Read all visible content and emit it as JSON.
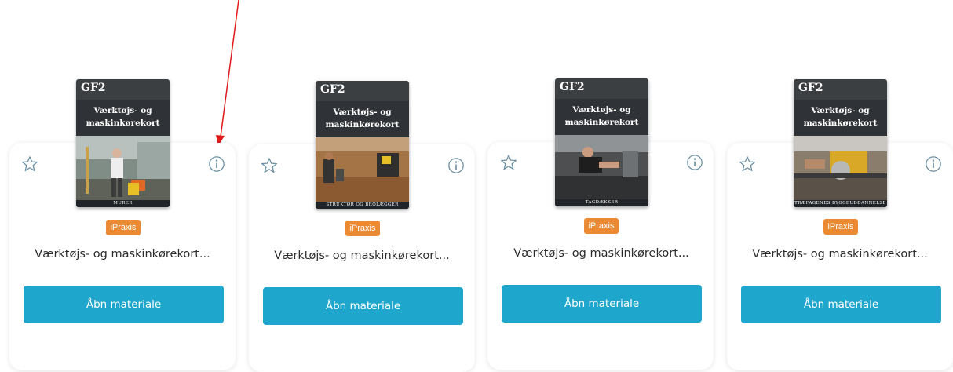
{
  "cards": [
    {
      "series": "GF2",
      "cover_title": "Værktøjs- og\nmaskinkørekort",
      "cover_footer": "MURER",
      "badge": "iPraxis",
      "title": "Værktøjs- og maskinkørekort...",
      "button_label": "Åbn materiale"
    },
    {
      "series": "GF2",
      "cover_title": "Værktøjs- og\nmaskinkørekort",
      "cover_footer": "STRUKTØR OG BROLÆGGER",
      "badge": "iPraxis",
      "title": "Værktøjs- og maskinkørekort...",
      "button_label": "Åbn materiale"
    },
    {
      "series": "GF2",
      "cover_title": "Værktøjs- og\nmaskinkørekort",
      "cover_footer": "TAGDÆKKER",
      "badge": "iPraxis",
      "title": "Værktøjs- og maskinkørekort...",
      "button_label": "Åbn materiale"
    },
    {
      "series": "GF2",
      "cover_title": "Værktøjs- og\nmaskinkørekort",
      "cover_footer": "TRÆFAGENES BYGGEUDDANNELSE",
      "badge": "iPraxis",
      "title": "Værktøjs- og maskinkørekort...",
      "button_label": "Åbn materiale"
    }
  ],
  "colors": {
    "button": "#1fa6cc",
    "badge": "#ec8a33",
    "icon": "#6b8fa3",
    "annotation_arrow": "#e11a1a"
  }
}
